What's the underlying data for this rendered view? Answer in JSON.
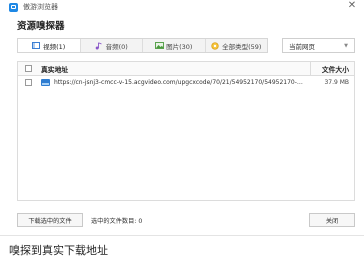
{
  "window": {
    "app_title": "傲游浏览器",
    "close_glyph": "✕"
  },
  "heading": "资源嗅探器",
  "tabs": [
    {
      "label": "视频(1)",
      "icon": "video-icon",
      "active": true
    },
    {
      "label": "音频(0)",
      "icon": "music-note-icon",
      "active": false
    },
    {
      "label": "图片(30)",
      "icon": "image-icon",
      "active": false
    },
    {
      "label": "全部类型(59)",
      "icon": "all-types-icon",
      "active": false
    }
  ],
  "scope_select": {
    "value": "当前网页",
    "caret": "▼"
  },
  "table": {
    "headers": {
      "url": "真实地址",
      "size": "文件大小"
    },
    "rows": [
      {
        "url": "https://cn-jsnj3-cmcc-v-15.acgvideo.com/upgcxcode/70/21/54952170/54952170-1-32.f...",
        "size": "37.9 MB"
      }
    ]
  },
  "footer": {
    "download_label": "下载选中的文件",
    "selected_count_label": "选中的文件数目: 0",
    "close_label": "关闭"
  },
  "caption": "嗅探到真实下载地址",
  "colors": {
    "accent": "#1e88e5",
    "file_icon": "#2e7dd1"
  }
}
